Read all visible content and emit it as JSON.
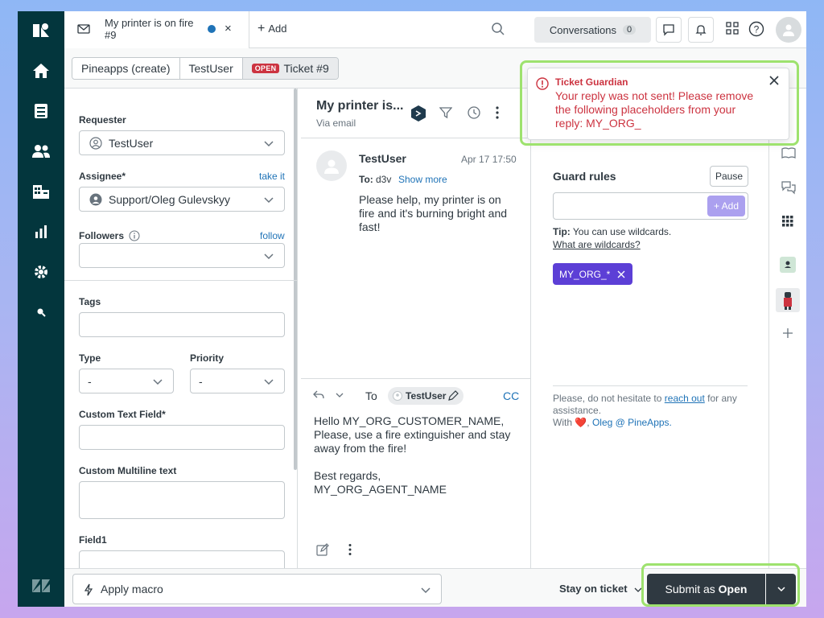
{
  "tab": {
    "title": "My printer is on fire #9",
    "close": "×"
  },
  "topbar": {
    "add_label": "Add",
    "conversations_label": "Conversations",
    "conversations_count": "0"
  },
  "breadcrumb": {
    "items": [
      "Pineapps (create)",
      "TestUser"
    ],
    "status": "OPEN",
    "ticket": "Ticket #9"
  },
  "props": {
    "requester_label": "Requester",
    "requester_value": "TestUser",
    "assignee_label": "Assignee*",
    "assignee_link": "take it",
    "assignee_value": "Support/Oleg Gulevskyy",
    "followers_label": "Followers",
    "followers_link": "follow",
    "tags_label": "Tags",
    "type_label": "Type",
    "type_value": "-",
    "priority_label": "Priority",
    "priority_value": "-",
    "custom_text_label": "Custom Text Field*",
    "custom_multiline_label": "Custom Multiline text",
    "field1_label": "Field1"
  },
  "conversation": {
    "title": "My printer is...",
    "channel": "Via email",
    "author": "TestUser",
    "time": "Apr 17 17:50",
    "to_label": "To:",
    "to_value": "d3v",
    "show_more": "Show more",
    "body": "Please help, my printer is on fire and it's burning bright and fast!"
  },
  "reply": {
    "to_label": "To",
    "recipient": "TestUser",
    "cc": "CC",
    "line1": "Hello MY_ORG_CUSTOMER_NAME,",
    "line2": "Please, use a fire extinguisher and stay away from the fire!",
    "line3": "Best regards,",
    "line4": "MY_ORG_AGENT_NAME"
  },
  "guardian": {
    "notify_title": "Ticket Guardian",
    "notify_body": "Your reply was not sent! Please remove the following placeholders from your reply: MY_ORG_",
    "rules_label": "Guard rules",
    "pause_label": "Pause",
    "add_label": "+ Add",
    "tip_bold": "Tip:",
    "tip_text": "You can use wildcards.",
    "tip_link": "What are wildcards?",
    "rule_tag": "MY_ORG_*",
    "footer_text1": "Please, do not hesitate to",
    "footer_link": "reach out",
    "footer_text2": "for any assistance.",
    "footer_with": "With",
    "footer_heart": "❤️",
    "footer_signature": "Oleg @ PineApps."
  },
  "bottom": {
    "macro_label": "Apply macro",
    "stay_label": "Stay on ticket",
    "submit_prefix": "Submit as",
    "submit_status": "Open"
  },
  "colors": {
    "rail": "#03363d",
    "accent": "#1f73b7",
    "error": "#cc3340",
    "tag": "#5c3fd6",
    "highlight": "#9ee26e"
  }
}
